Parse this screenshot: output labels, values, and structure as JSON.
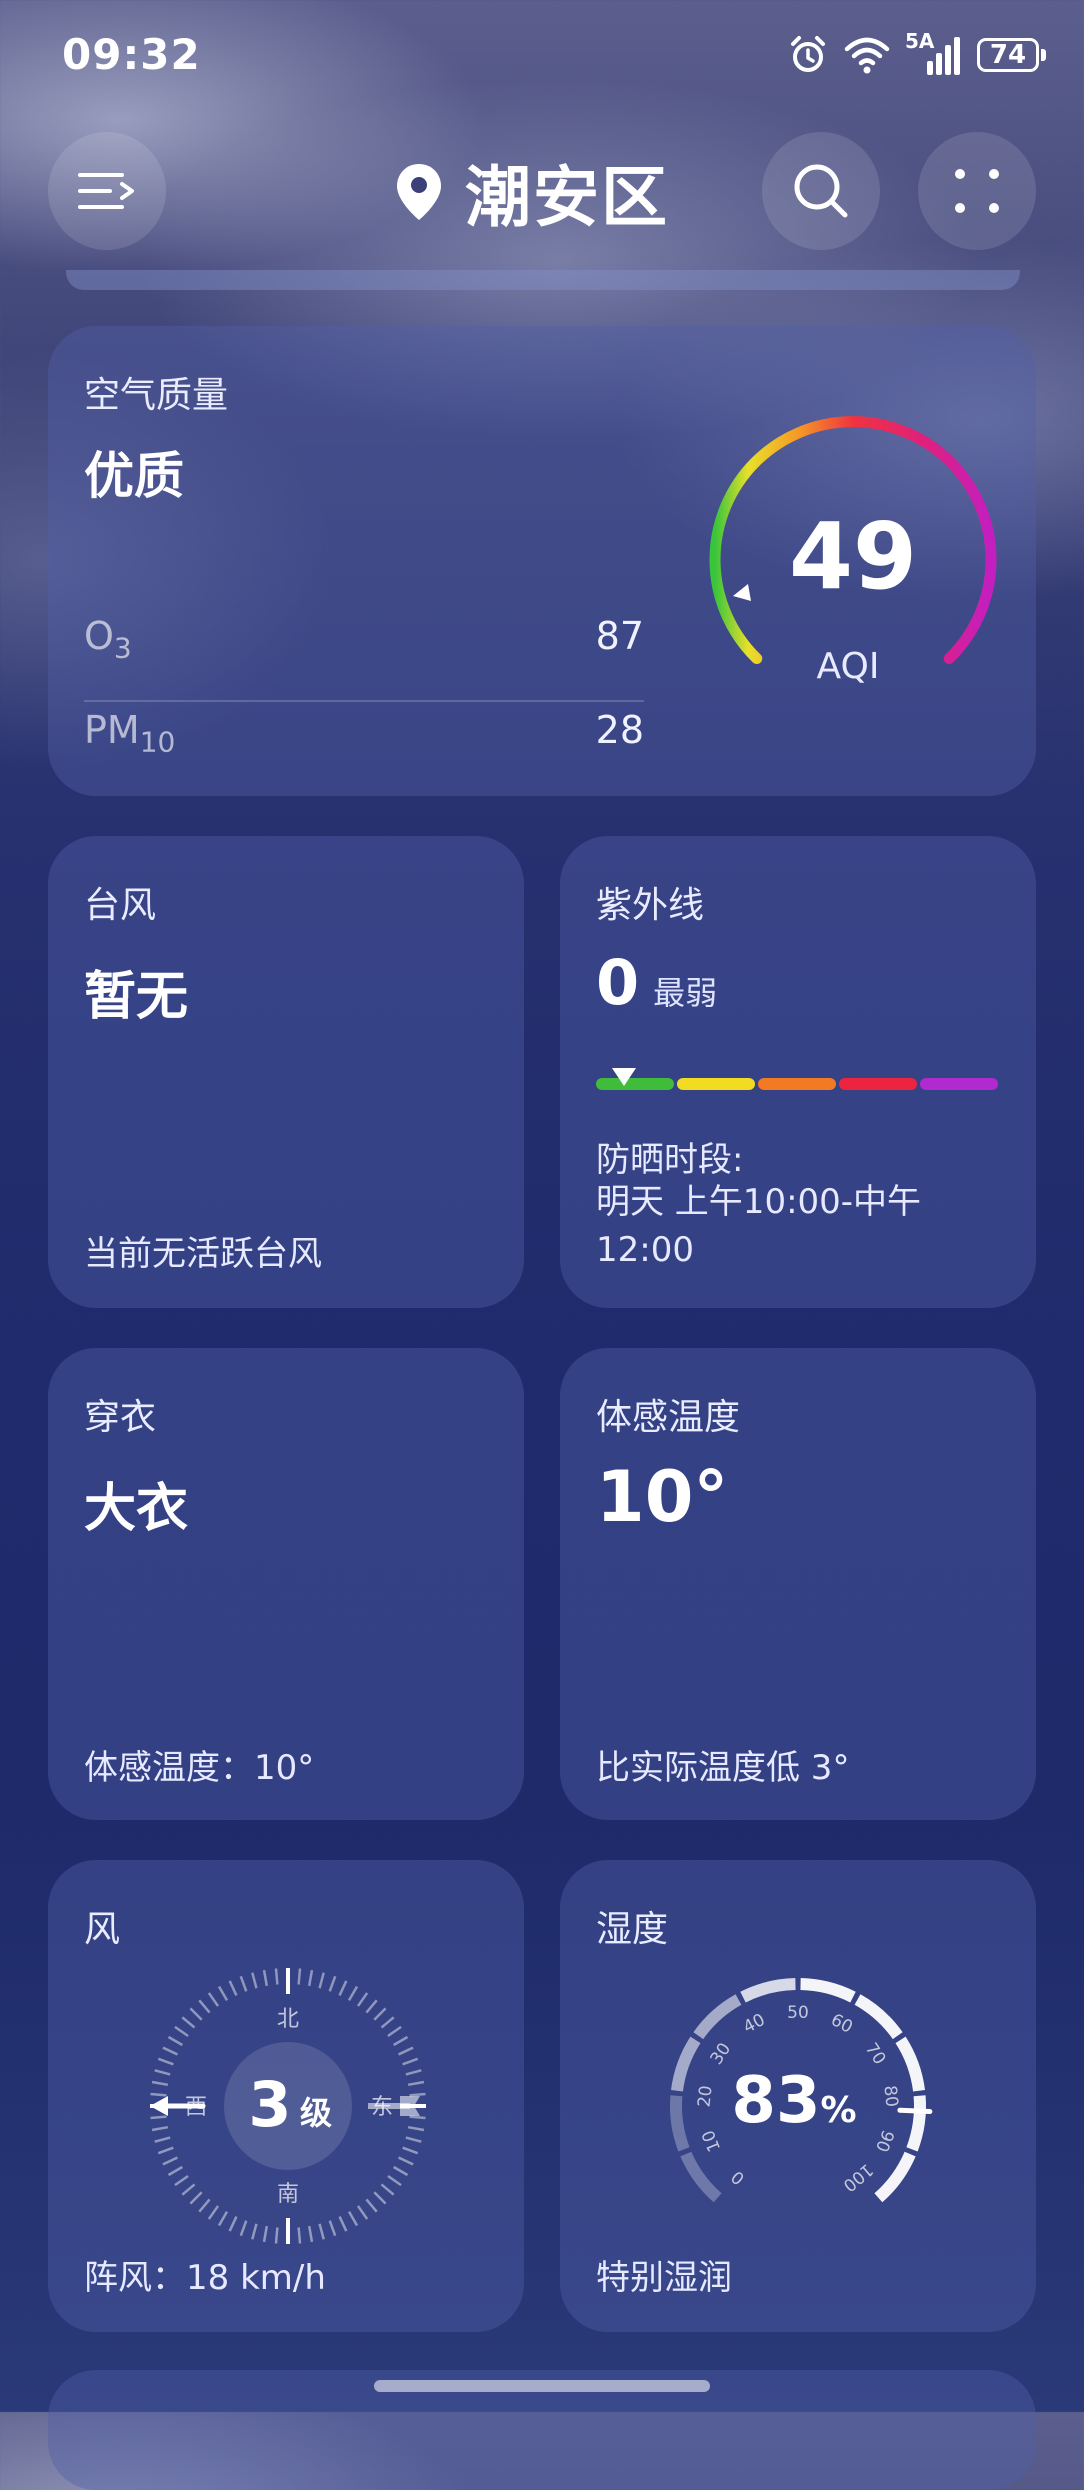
{
  "status_bar": {
    "time": "09:32",
    "network": "5A",
    "battery": "74"
  },
  "header": {
    "location": "潮安区"
  },
  "air_quality": {
    "title": "空气质量",
    "level": "优质",
    "aqi": "49",
    "aqi_unit": "AQI",
    "pollutants": [
      {
        "name": "O",
        "sub": "3",
        "value": "87"
      },
      {
        "name": "PM",
        "sub": "10",
        "value": "28"
      }
    ]
  },
  "typhoon": {
    "title": "台风",
    "value": "暂无",
    "note": "当前无活跃台风"
  },
  "uv": {
    "title": "紫外线",
    "index": "0",
    "level": "最弱",
    "level_fraction": 0.07,
    "scale_colors": [
      "#3fbd3a",
      "#f2dc22",
      "#f27a22",
      "#ec2440",
      "#b12ad0"
    ],
    "sun_label": "防晒时段:",
    "sun_time": "明天 上午10:00-中午12:00"
  },
  "clothing": {
    "title": "穿衣",
    "value": "大衣",
    "note": "体感温度：10°"
  },
  "feels_like": {
    "title": "体感温度",
    "value": "10°",
    "note": "比实际温度低 3°"
  },
  "wind": {
    "title": "风",
    "level_number": "3",
    "level_unit": "级",
    "directions": {
      "north": "北",
      "south": "南",
      "east": "东",
      "west": "西"
    },
    "gust": "阵风：18 km/h"
  },
  "humidity": {
    "title": "湿度",
    "value": "83",
    "unit": "%",
    "fraction": 0.83,
    "ticks": [
      "0",
      "10",
      "20",
      "30",
      "40",
      "50",
      "60",
      "70",
      "80",
      "90",
      "100"
    ],
    "note": "特别湿润"
  }
}
